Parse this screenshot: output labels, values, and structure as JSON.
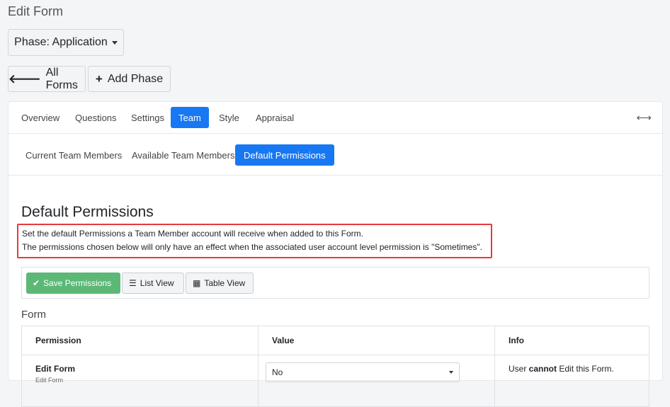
{
  "page": {
    "title": "Edit Form"
  },
  "phase_button": {
    "label": "Phase: Application"
  },
  "nav_buttons": {
    "all_forms": "All Forms",
    "add_phase": "Add Phase"
  },
  "tabs": [
    "Overview",
    "Questions",
    "Settings",
    "Team",
    "Style",
    "Appraisal"
  ],
  "active_tab": "Team",
  "subtabs": [
    "Current Team Members",
    "Available Team Members",
    "Default Permissions"
  ],
  "active_subtab": "Default Permissions",
  "section": {
    "title": "Default Permissions",
    "description": [
      "Set the default Permissions a Team Member account will receive when added to this Form.",
      "The permissions chosen below will only have an effect when the associated user account level permission is \"Sometimes\"."
    ]
  },
  "toolbar": {
    "save": "Save Permissions",
    "list_view": "List View",
    "table_view": "Table View"
  },
  "form_label": "Form",
  "table": {
    "headers": [
      "Permission",
      "Value",
      "Info"
    ],
    "rows": [
      {
        "permission": "Edit Form",
        "sub": "Edit Form",
        "value": "No",
        "info_pre": "User ",
        "info_bold": "cannot",
        "info_post": " Edit this Form."
      }
    ]
  },
  "colors": {
    "accent": "#1877f2",
    "save": "#5cb877",
    "highlight_border": "#e8393b"
  }
}
